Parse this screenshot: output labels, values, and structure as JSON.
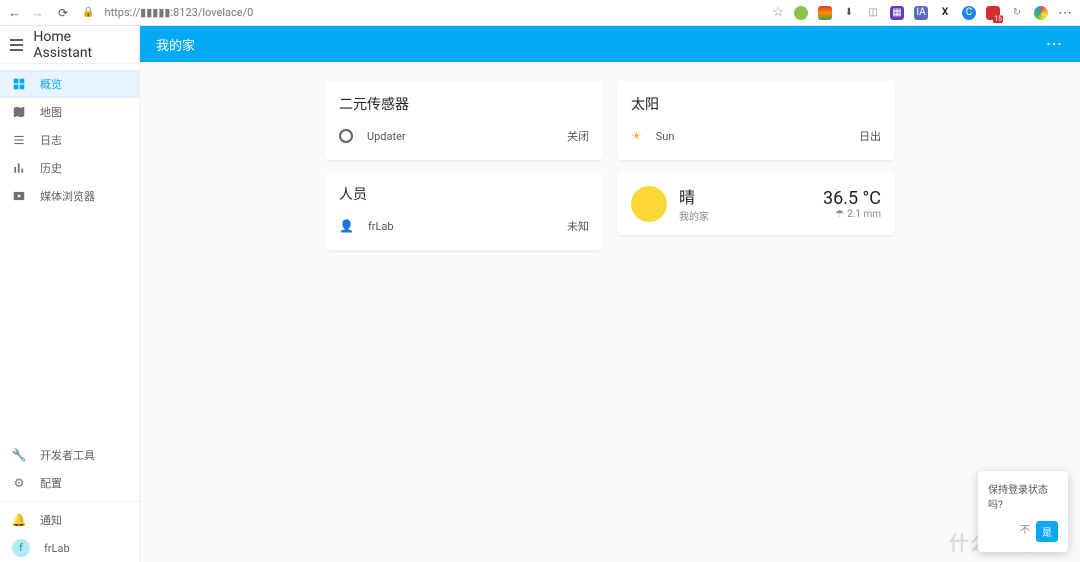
{
  "browser": {
    "url": "https://▮▮▮▮▮:8123/lovelace/0",
    "ext_badge": "15"
  },
  "app_title": "Home Assistant",
  "sidebar": {
    "items": [
      {
        "label": "概览",
        "icon": "overview"
      },
      {
        "label": "地图",
        "icon": "map"
      },
      {
        "label": "日志",
        "icon": "logbook"
      },
      {
        "label": "历史",
        "icon": "history"
      },
      {
        "label": "媒体浏览器",
        "icon": "media"
      }
    ],
    "bottom": [
      {
        "label": "开发者工具",
        "icon": "wrench"
      },
      {
        "label": "配置",
        "icon": "gear"
      }
    ],
    "notify": "通知",
    "user": {
      "initial": "f",
      "name": "frLab"
    }
  },
  "topbar": {
    "title": "我的家"
  },
  "cards": {
    "binary": {
      "title": "二元传感器",
      "entity": "Updater",
      "state": "关闭"
    },
    "sun": {
      "title": "太阳",
      "entity": "Sun",
      "state": "日出"
    },
    "person": {
      "title": "人员",
      "entity": "frLab",
      "state": "未知"
    },
    "weather": {
      "condition": "晴",
      "location": "我的家",
      "temperature": "36.5 °C",
      "precip": "2.1 mm"
    }
  },
  "toast": {
    "message": "保持登录状态吗?",
    "dismiss": "不",
    "confirm": "是"
  },
  "watermark": "什么值得买"
}
